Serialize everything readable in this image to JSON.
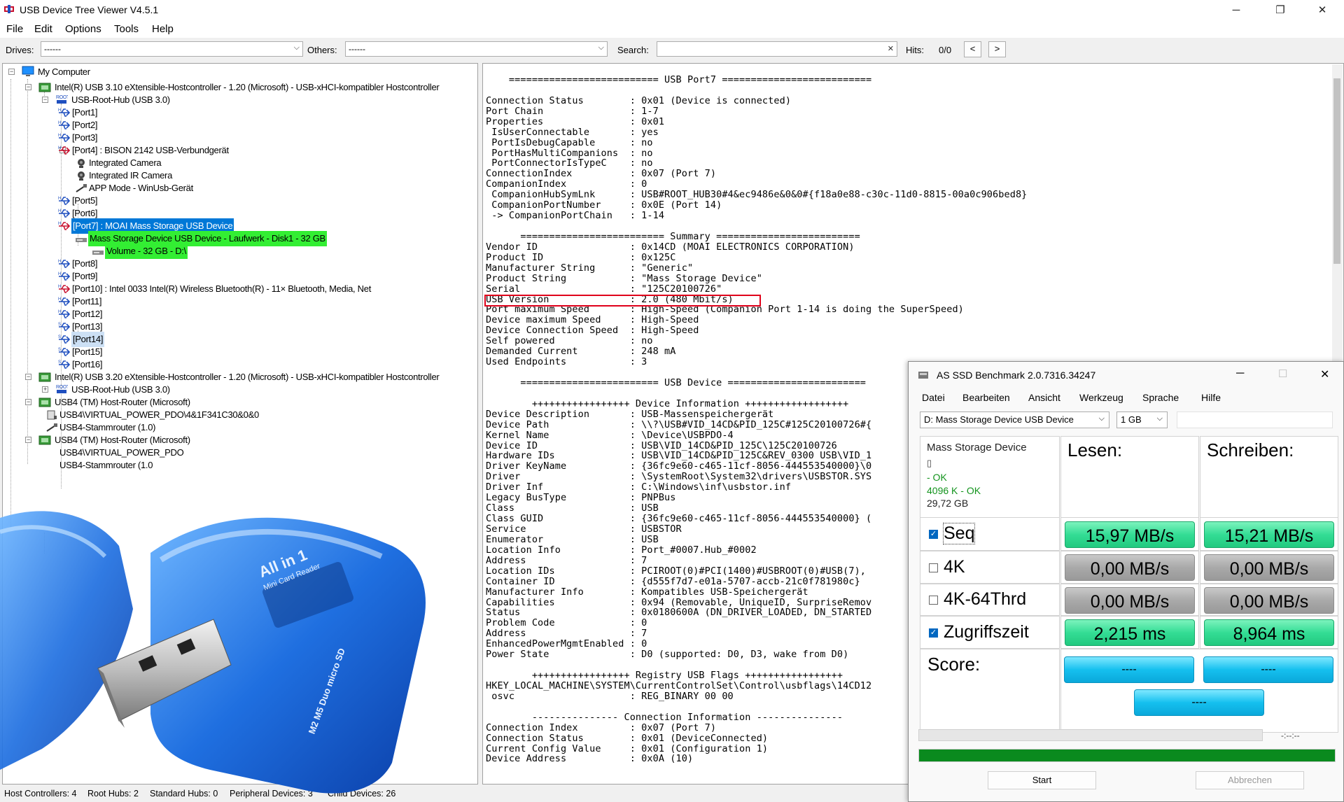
{
  "window": {
    "title": "USB Device Tree Viewer V4.5.1",
    "minimize": "─",
    "maximize": "❐",
    "close": "✕"
  },
  "menu": [
    "File",
    "Edit",
    "Options",
    "Tools",
    "Help"
  ],
  "toolbar": {
    "drives_label": "Drives:",
    "drives_value": "------",
    "others_label": "Others:",
    "others_value": "------",
    "search_label": "Search:",
    "search_value": "",
    "search_clear": "✕",
    "hits_label": "Hits:",
    "hits_value": "0/0",
    "prev": "<",
    "next": ">"
  },
  "tree": [
    {
      "text": "My Computer"
    },
    {
      "text": "Intel(R) USB 3.10 eXtensible-Hostcontroller - 1.20 (Microsoft) - USB-xHCI-kompatibler Hostcontroller"
    },
    {
      "text": "USB-Root-Hub (USB 3.0)"
    },
    {
      "text": "[Port1]"
    },
    {
      "text": "[Port2]"
    },
    {
      "text": "[Port3]"
    },
    {
      "text": "[Port4] : BISON 2142 USB-Verbundgerät"
    },
    {
      "text": "Integrated Camera"
    },
    {
      "text": "Integrated IR Camera"
    },
    {
      "text": "APP Mode - WinUsb-Gerät"
    },
    {
      "text": "[Port5]"
    },
    {
      "text": "[Port6]"
    },
    {
      "text": "[Port7] : MOAI Mass Storage USB Device"
    },
    {
      "text": "Mass Storage Device USB Device - Laufwerk - Disk1 - 32 GB"
    },
    {
      "text": "Volume - 32 GB - D:\\"
    },
    {
      "text": "[Port8]"
    },
    {
      "text": "[Port9]"
    },
    {
      "text": "[Port10] : Intel 0033 Intel(R) Wireless Bluetooth(R) - 11× Bluetooth, Media, Net"
    },
    {
      "text": "[Port11]"
    },
    {
      "text": "[Port12]"
    },
    {
      "text": "[Port13]"
    },
    {
      "text": "[Port14]"
    },
    {
      "text": "[Port15]"
    },
    {
      "text": "[Port16]"
    },
    {
      "text": "Intel(R) USB 3.20 eXtensible-Hostcontroller - 1.20 (Microsoft) - USB-xHCI-kompatibler Hostcontroller"
    },
    {
      "text": "USB-Root-Hub (USB 3.0)"
    },
    {
      "text": "USB4 (TM) Host-Router (Microsoft)"
    },
    {
      "text": "USB4\\VIRTUAL_POWER_PDO\\4&1F341C30&0&0"
    },
    {
      "text": "USB4-Stammrouter (1.0)"
    },
    {
      "text": "USB4 (TM) Host-Router (Microsoft)"
    },
    {
      "text": "USB4\\VIRTUAL_POWER_PDO"
    },
    {
      "text": "USB4-Stammrouter (1.0"
    }
  ],
  "detail_lines": [
    "    ========================== USB Port7 ==========================",
    "",
    "Connection Status        : 0x01 (Device is connected)",
    "Port Chain               : 1-7",
    "Properties               : 0x01",
    " IsUserConnectable       : yes",
    " PortIsDebugCapable      : no",
    " PortHasMultiCompanions  : no",
    " PortConnectorIsTypeC    : no",
    "ConnectionIndex          : 0x07 (Port 7)",
    "CompanionIndex           : 0",
    " CompanionHubSymLnk      : USB#ROOT_HUB30#4&ec9486e&0&0#{f18a0e88-c30c-11d0-8815-00a0c906bed8}",
    " CompanionPortNumber     : 0x0E (Port 14)",
    " -> CompanionPortChain   : 1-14",
    "",
    "      ========================= Summary =========================",
    "Vendor ID                : 0x14CD (MOAI ELECTRONICS CORPORATION)",
    "Product ID               : 0x125C",
    "Manufacturer String      : \"Generic\"",
    "Product String           : \"Mass Storage Device\"",
    "Serial                   : \"125C20100726\"",
    "USB Version              : 2.0 (480 Mbit/s)",
    "Port maximum Speed       : High-Speed (Companion Port 1-14 is doing the SuperSpeed)",
    "Device maximum Speed     : High-Speed",
    "Device Connection Speed  : High-Speed",
    "Self powered             : no",
    "Demanded Current         : 248 mA",
    "Used Endpoints           : 3",
    "",
    "      ======================== USB Device ========================",
    "",
    "        +++++++++++++++++ Device Information ++++++++++++++++++",
    "Device Description       : USB-Massenspeichergerät",
    "Device Path              : \\\\?\\USB#VID_14CD&PID_125C#125C20100726#{",
    "Kernel Name              : \\Device\\USBPDO-4",
    "Device ID                : USB\\VID_14CD&PID_125C\\125C20100726",
    "Hardware IDs             : USB\\VID_14CD&PID_125C&REV_0300 USB\\VID_1",
    "Driver KeyName           : {36fc9e60-c465-11cf-8056-444553540000}\\0",
    "Driver                   : \\SystemRoot\\System32\\drivers\\USBSTOR.SYS",
    "Driver Inf               : C:\\Windows\\inf\\usbstor.inf",
    "Legacy BusType           : PNPBus",
    "Class                    : USB",
    "Class GUID               : {36fc9e60-c465-11cf-8056-444553540000} (",
    "Service                  : USBSTOR",
    "Enumerator               : USB",
    "Location Info            : Port_#0007.Hub_#0002",
    "Address                  : 7",
    "Location IDs             : PCIROOT(0)#PCI(1400)#USBROOT(0)#USB(7),",
    "Container ID             : {d555f7d7-e01a-5707-accb-21c0f781980c}",
    "Manufacturer Info        : Kompatibles USB-Speichergerät",
    "Capabilities             : 0x94 (Removable, UniqueID, SurpriseRemov",
    "Status                   : 0x0180600A (DN_DRIVER_LOADED, DN_STARTED",
    "Problem Code             : 0",
    "Address                  : 7",
    "EnhancedPowerMgmtEnabled : 0",
    "Power State              : D0 (supported: D0, D3, wake from D0)",
    "",
    "        +++++++++++++++++ Registry USB Flags +++++++++++++++++",
    "HKEY_LOCAL_MACHINE\\SYSTEM\\CurrentControlSet\\Control\\usbflags\\14CD12",
    " osvc                    : REG_BINARY 00 00",
    "",
    "        --------------- Connection Information ---------------",
    "Connection Index         : 0x07 (Port 7)",
    "Connection Status        : 0x01 (DeviceConnected)",
    "Current Config Value     : 0x01 (Configuration 1)",
    "Device Address           : 0x0A (10)"
  ],
  "status": [
    "Host Controllers: 4",
    "Root Hubs: 2",
    "Standard Hubs: 0",
    "Peripheral Devices: 3",
    "Child Devices: 26"
  ],
  "photo": {
    "label_top": "All in 1",
    "label_sub": "Mini Card Reader",
    "slots": "M2  M5 Duo  micro SD"
  },
  "ssd": {
    "title": "AS SSD Benchmark 2.0.7316.34247",
    "menu": [
      "Datei",
      "Bearbeiten",
      "Ansicht",
      "Werkzeug",
      "Sprache",
      "Hilfe"
    ],
    "drive": "D: Mass Storage Device USB Device",
    "size": "1 GB",
    "info_name": "Mass Storage Device",
    "info_line2": "▯",
    "info_ok1": " - OK",
    "info_ok2": "4096 K - OK",
    "info_size": "29,72 GB",
    "col_read": "Lesen:",
    "col_write": "Schreiben:",
    "rows": [
      {
        "label": "Seq",
        "checked": true,
        "read": "15,97 MB/s",
        "write": "15,21 MB/s"
      },
      {
        "label": "4K",
        "checked": false,
        "read": "0,00 MB/s",
        "write": "0,00 MB/s"
      },
      {
        "label": "4K-64Thrd",
        "checked": false,
        "read": "0,00 MB/s",
        "write": "0,00 MB/s"
      },
      {
        "label": "Zugriffszeit",
        "checked": true,
        "read": "2,215 ms",
        "write": "8,964 ms"
      }
    ],
    "score_label": "Score:",
    "score_read": "----",
    "score_write": "----",
    "score_total": "----",
    "timer": "-:--:--",
    "progress": 1.0,
    "start": "Start",
    "abort": "Abbrechen",
    "colors": {
      "green": "#2cd98d",
      "gray": "#a9a9a9",
      "blue": "#15c0ef",
      "progress": "#0a8a1e"
    }
  }
}
